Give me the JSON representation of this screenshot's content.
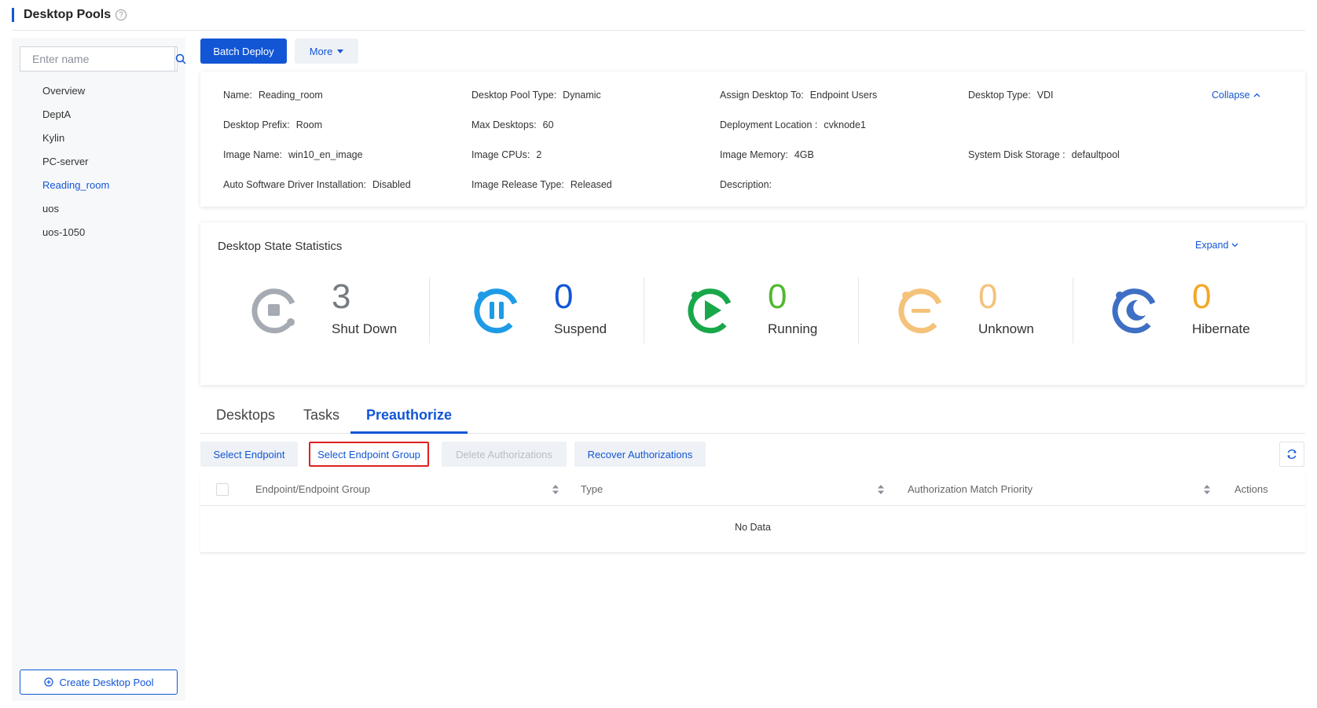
{
  "header": {
    "title": "Desktop Pools"
  },
  "sidebar": {
    "search_placeholder": "Enter name",
    "items": [
      {
        "label": "Overview",
        "active": false
      },
      {
        "label": "DeptA",
        "active": false
      },
      {
        "label": "Kylin",
        "active": false
      },
      {
        "label": "PC-server",
        "active": false
      },
      {
        "label": "Reading_room",
        "active": true
      },
      {
        "label": "uos",
        "active": false
      },
      {
        "label": "uos-1050",
        "active": false
      }
    ],
    "create_label": "Create Desktop Pool"
  },
  "toolbar": {
    "batch_deploy_label": "Batch Deploy",
    "more_label": "More"
  },
  "info": {
    "collapse_label": "Collapse",
    "name": {
      "label": "Name:",
      "value": "Reading_room"
    },
    "pool_type": {
      "label": "Desktop Pool Type:",
      "value": "Dynamic"
    },
    "assign_to": {
      "label": "Assign Desktop To:",
      "value": "Endpoint Users"
    },
    "desktop_type": {
      "label": "Desktop Type:",
      "value": "VDI"
    },
    "prefix": {
      "label": "Desktop Prefix:",
      "value": "Room"
    },
    "max_desktops": {
      "label": "Max Desktops:",
      "value": "60"
    },
    "deploy_location": {
      "label": "Deployment Location :",
      "value": "cvknode1"
    },
    "image_name": {
      "label": "Image Name:",
      "value": "win10_en_image"
    },
    "image_cpus": {
      "label": "Image CPUs:",
      "value": "2"
    },
    "image_memory": {
      "label": "Image Memory:",
      "value": "4GB"
    },
    "system_disk": {
      "label": "System Disk Storage :",
      "value": "defaultpool"
    },
    "auto_driver": {
      "label": "Auto Software Driver Installation:",
      "value": "Disabled"
    },
    "release_type": {
      "label": "Image Release Type:",
      "value": "Released"
    },
    "description": {
      "label": "Description:",
      "value": ""
    }
  },
  "stats": {
    "title": "Desktop State Statistics",
    "expand_label": "Expand",
    "items": [
      {
        "count": "3",
        "label": "Shut Down",
        "color": "#a6abb3"
      },
      {
        "count": "0",
        "label": "Suspend",
        "color": "#1e9be6"
      },
      {
        "count": "0",
        "label": "Running",
        "color": "#18a84a"
      },
      {
        "count": "0",
        "label": "Unknown",
        "color": "#f4c27a"
      },
      {
        "count": "0",
        "label": "Hibernate",
        "color": "#3f6fc4"
      }
    ],
    "count_colors": [
      "#777b82",
      "#1256d6",
      "#52b830",
      "#f4c27a",
      "#f5a623"
    ]
  },
  "tabs": [
    {
      "label": "Desktops",
      "active": false
    },
    {
      "label": "Tasks",
      "active": false
    },
    {
      "label": "Preauthorize",
      "active": true
    }
  ],
  "actions": {
    "select_endpoint": "Select Endpoint",
    "select_endpoint_group": "Select Endpoint Group",
    "delete_authorizations": "Delete Authorizations",
    "recover_authorizations": "Recover Authorizations"
  },
  "table": {
    "columns": [
      "Endpoint/Endpoint Group",
      "Type",
      "Authorization Match Priority",
      "Actions"
    ],
    "empty_text": "No Data"
  }
}
